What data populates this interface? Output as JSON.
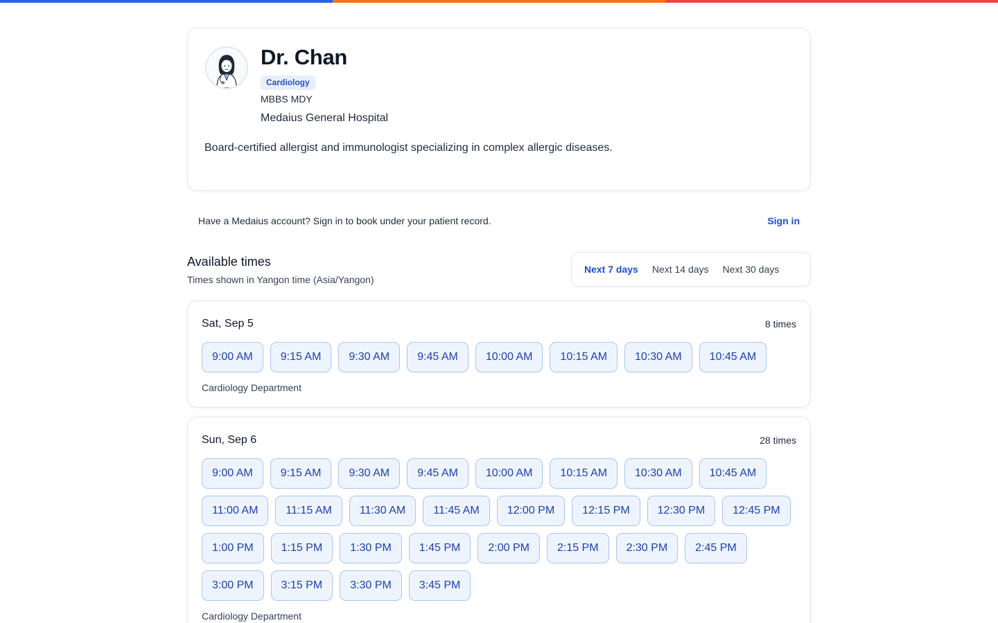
{
  "colors": {
    "bar_blue": "#2563eb",
    "bar_orange": "#f97316",
    "bar_red": "#ef4444",
    "accent": "#1d4ed8"
  },
  "doctor": {
    "name": "Dr. Chan",
    "specialty": "Cardiology",
    "qualifications": "MBBS MDY",
    "hospital": "Medaius General Hospital",
    "bio": "Board-certified allergist and immunologist specializing in complex allergic diseases.",
    "avatar_icon": "doctor-avatar-illustration"
  },
  "signin": {
    "prompt": "Have a Medaius account? Sign in to book under your patient record.",
    "link": "Sign in"
  },
  "availability": {
    "title": "Available times",
    "timezone_note": "Times shown in Yangon time (Asia/Yangon)",
    "ranges": [
      {
        "label": "Next 7 days",
        "active": true
      },
      {
        "label": "Next 14 days",
        "active": false
      },
      {
        "label": "Next 30 days",
        "active": false
      }
    ]
  },
  "days": [
    {
      "date": "Sat, Sep 5",
      "count": "8 times",
      "department": "Cardiology Department",
      "slots": [
        "9:00 AM",
        "9:15 AM",
        "9:30 AM",
        "9:45 AM",
        "10:00 AM",
        "10:15 AM",
        "10:30 AM",
        "10:45 AM"
      ]
    },
    {
      "date": "Sun, Sep 6",
      "count": "28 times",
      "department": "Cardiology Department",
      "slots": [
        "9:00 AM",
        "9:15 AM",
        "9:30 AM",
        "9:45 AM",
        "10:00 AM",
        "10:15 AM",
        "10:30 AM",
        "10:45 AM",
        "11:00 AM",
        "11:15 AM",
        "11:30 AM",
        "11:45 AM",
        "12:00 PM",
        "12:15 PM",
        "12:30 PM",
        "12:45 PM",
        "1:00 PM",
        "1:15 PM",
        "1:30 PM",
        "1:45 PM",
        "2:00 PM",
        "2:15 PM",
        "2:30 PM",
        "2:45 PM",
        "3:00 PM",
        "3:15 PM",
        "3:30 PM",
        "3:45 PM"
      ]
    }
  ]
}
